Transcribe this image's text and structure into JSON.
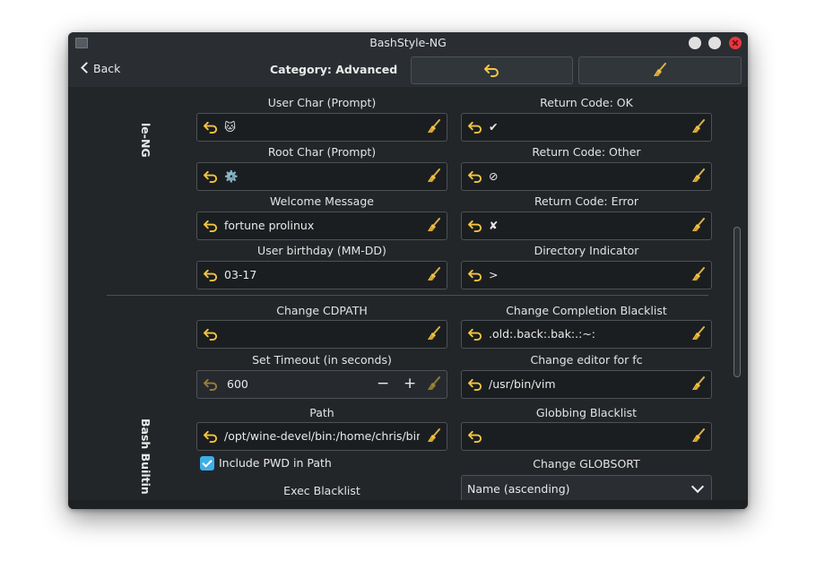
{
  "window": {
    "title": "BashStyle-NG"
  },
  "toolbar": {
    "back_label": "Back",
    "category_title": "Category: Advanced"
  },
  "sections": {
    "top": "le-NG",
    "builtin": "Bash Builtin"
  },
  "prompt_fields": [
    {
      "label": "User Char (Prompt)",
      "value": "🐱"
    },
    {
      "label": "Return Code: OK",
      "value": "✔"
    },
    {
      "label": "Root Char (Prompt)",
      "value": "⚙️"
    },
    {
      "label": "Return Code: Other",
      "value": "⊘"
    },
    {
      "label": "Welcome Message",
      "value": "fortune prolinux"
    },
    {
      "label": "Return Code: Error",
      "value": "✘"
    },
    {
      "label": "User birthday (MM-DD)",
      "value": "03-17"
    },
    {
      "label": "Directory Indicator",
      "value": ">"
    }
  ],
  "builtin_fields": {
    "cdpath": {
      "label": "Change CDPATH",
      "value": ""
    },
    "completion_blacklist": {
      "label": "Change Completion Blacklist",
      "value": ".old:.back:.bak:.:~:"
    },
    "timeout": {
      "label": "Set Timeout (in seconds)",
      "value": "600",
      "minus": "−",
      "plus": "+"
    },
    "editor": {
      "label": "Change editor for fc",
      "value": "/usr/bin/vim"
    },
    "path": {
      "label": "Path",
      "value": "/opt/wine-devel/bin:/home/chris/bin:/h"
    },
    "globbing": {
      "label": "Globbing Blacklist",
      "value": ""
    },
    "include_pwd": {
      "label": "Include PWD in Path",
      "checked": true
    },
    "globsort": {
      "label": "Change GLOBSORT",
      "value": "Name (ascending)"
    },
    "exec_blacklist": {
      "label": "Exec Blacklist"
    }
  },
  "colors": {
    "accent": "#3daee9",
    "icon_yellow": "#f5c542",
    "close": "#e5393f"
  }
}
